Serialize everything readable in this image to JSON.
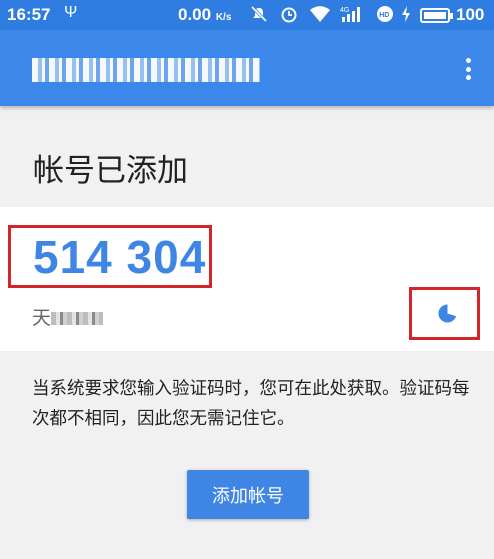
{
  "status_bar": {
    "time": "16:57",
    "usb_icon": "usb-icon",
    "network_speed": "0.00",
    "network_unit": "K/s",
    "icons": [
      "mute-icon",
      "alarm-icon",
      "wifi-icon",
      "signal-4g-icon",
      "hd-icon",
      "charging-icon",
      "battery-icon"
    ],
    "battery": "100"
  },
  "app_bar": {
    "title": "",
    "menu_icon": "more-vert-icon"
  },
  "heading": "帐号已添加",
  "account_card": {
    "code": "514 304",
    "account_prefix": "天",
    "timer_icon": "countdown-pie-icon",
    "timer_remaining_fraction": 0.7
  },
  "description": "当系统要求您输入验证码时，您可在此处获取。验证码每次都不相同，因此您无需记住它。",
  "add_button_label": "添加帐号",
  "colors": {
    "primary": "#3b87ea",
    "status_bar": "#2f7de1",
    "code": "#3f86e4",
    "highlight_box": "#d3262b",
    "background": "#f1f1f1"
  }
}
